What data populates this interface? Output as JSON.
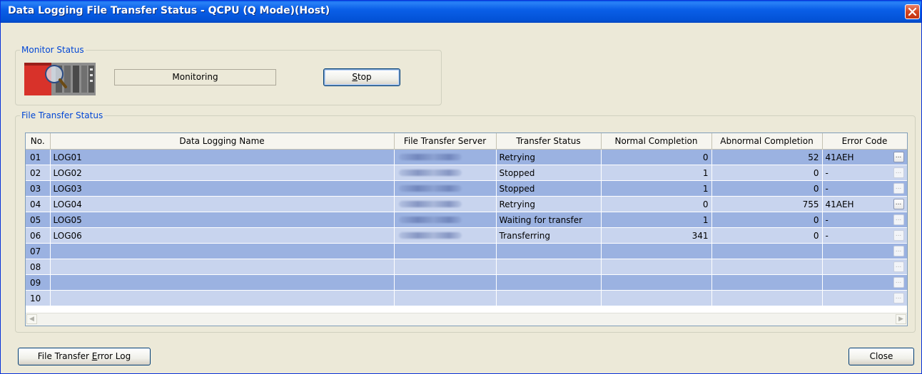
{
  "window": {
    "title": "Data Logging File Transfer Status - QCPU (Q Mode)(Host)",
    "close_icon": "close-icon"
  },
  "monitor": {
    "legend": "Monitor Status",
    "status_text": "Monitoring",
    "stop_label_accel": "S",
    "stop_label_rest": "top",
    "icon": "plc-monitor-icon"
  },
  "file_transfer": {
    "legend": "File Transfer Status",
    "columns": [
      "No.",
      "Data Logging Name",
      "File Transfer Server",
      "Transfer Status",
      "Normal Completion",
      "Abnormal Completion",
      "Error Code"
    ],
    "rows": [
      {
        "no": "01",
        "name": "LOG01",
        "status": "Retrying",
        "normal": "0",
        "abnormal": "52",
        "error": "41AEH",
        "detail_enabled": true
      },
      {
        "no": "02",
        "name": "LOG02",
        "status": "Stopped",
        "normal": "1",
        "abnormal": "0",
        "error": "-",
        "detail_enabled": false
      },
      {
        "no": "03",
        "name": "LOG03",
        "status": "Stopped",
        "normal": "1",
        "abnormal": "0",
        "error": "-",
        "detail_enabled": false
      },
      {
        "no": "04",
        "name": "LOG04",
        "status": "Retrying",
        "normal": "0",
        "abnormal": "755",
        "error": "41AEH",
        "detail_enabled": true
      },
      {
        "no": "05",
        "name": "LOG05",
        "status": "Waiting for transfer",
        "normal": "1",
        "abnormal": "0",
        "error": "-",
        "detail_enabled": false
      },
      {
        "no": "06",
        "name": "LOG06",
        "status": "Transferring",
        "normal": "341",
        "abnormal": "0",
        "error": "-",
        "detail_enabled": false
      },
      {
        "no": "07",
        "name": "",
        "status": "",
        "normal": "",
        "abnormal": "",
        "error": "",
        "detail_enabled": false
      },
      {
        "no": "08",
        "name": "",
        "status": "",
        "normal": "",
        "abnormal": "",
        "error": "",
        "detail_enabled": false
      },
      {
        "no": "09",
        "name": "",
        "status": "",
        "normal": "",
        "abnormal": "",
        "error": "",
        "detail_enabled": false
      },
      {
        "no": "10",
        "name": "",
        "status": "",
        "normal": "",
        "abnormal": "",
        "error": "",
        "detail_enabled": false
      }
    ],
    "detail_button_glyph": "..."
  },
  "footer": {
    "error_log_pre": "File Transfer ",
    "error_log_accel": "E",
    "error_log_post": "rror Log",
    "close_label": "Close"
  },
  "colors": {
    "title_bar": "#0a5fe8",
    "row_odd": "#9bb2e1",
    "row_even": "#c8d4ee",
    "legend": "#0046d5"
  }
}
